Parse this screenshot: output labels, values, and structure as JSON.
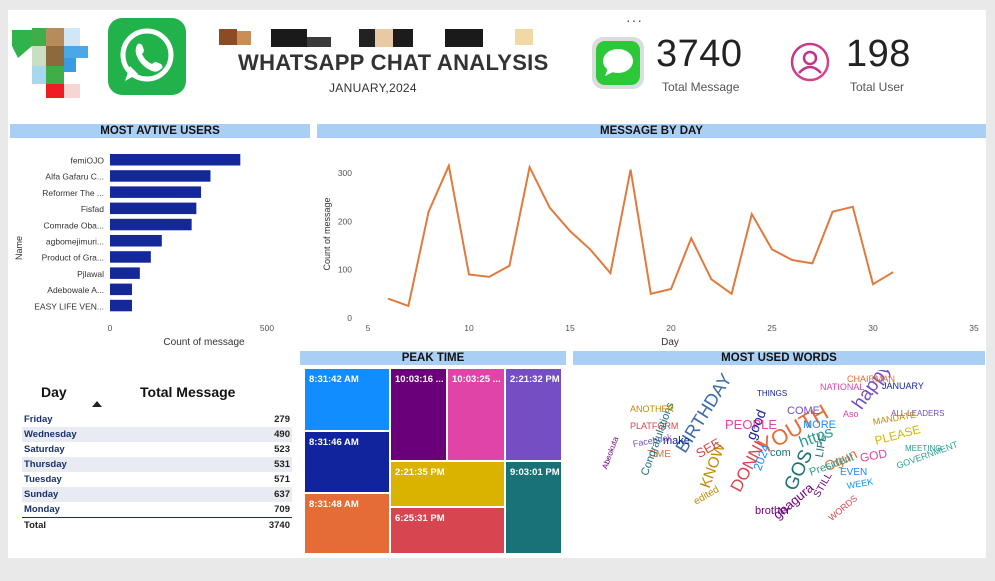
{
  "header": {
    "title": "WHATSAPP CHAT ANALYSIS",
    "subtitle": "JANUARY,2024",
    "more_options": "···"
  },
  "kpis": {
    "total_message_value": "3740",
    "total_message_label": "Total Message",
    "total_user_value": "198",
    "total_user_label": "Total User"
  },
  "active_users": {
    "banner": "MOST AVTIVE USERS",
    "ylabel": "Name",
    "xlabel": "Count of message",
    "xticks": [
      "0",
      "500"
    ],
    "xmax": 500,
    "bar_color": "#14289a",
    "users": [
      {
        "name": "femiOJO",
        "count": 415
      },
      {
        "name": "Alfa Gafaru C...",
        "count": 320
      },
      {
        "name": "Reformer The ...",
        "count": 290
      },
      {
        "name": "Fisfad",
        "count": 275
      },
      {
        "name": "Comrade Oba...",
        "count": 260
      },
      {
        "name": "agbomejimuri...",
        "count": 165
      },
      {
        "name": "Product of Gra...",
        "count": 130
      },
      {
        "name": "Pjlawal",
        "count": 95
      },
      {
        "name": "Adebowale A...",
        "count": 70
      },
      {
        "name": "EASY LIFE VEN...",
        "count": 70
      }
    ]
  },
  "chart_data": {
    "type": "line",
    "title": "MESSAGE BY DAY",
    "xlabel": "Day",
    "ylabel": "Count of message",
    "xlim": [
      5,
      35
    ],
    "ylim": [
      0,
      300
    ],
    "xticks": [
      5,
      10,
      15,
      20,
      25,
      30,
      35
    ],
    "yticks": [
      0,
      100,
      200,
      300
    ],
    "color": "#e07a3f",
    "x": [
      6,
      7,
      8,
      9,
      10,
      11,
      12,
      13,
      14,
      15,
      16,
      17,
      18,
      19,
      20,
      21,
      22,
      23,
      24,
      25,
      26,
      27,
      28,
      29,
      30,
      31
    ],
    "y": [
      40,
      25,
      220,
      315,
      90,
      85,
      108,
      312,
      228,
      180,
      142,
      93,
      307,
      50,
      60,
      165,
      80,
      50,
      215,
      142,
      120,
      113,
      220,
      230,
      70,
      95
    ]
  },
  "peak_time": {
    "banner": "PEAK TIME",
    "tiles": [
      {
        "label": "8:31:42 AM",
        "color": "#118dff"
      },
      {
        "label": "8:31:46 AM",
        "color": "#12239e"
      },
      {
        "label": "8:31:48 AM",
        "color": "#e66c37"
      },
      {
        "label": "10:03:16 ...",
        "color": "#6b007b"
      },
      {
        "label": "10:03:25 ...",
        "color": "#e044a7"
      },
      {
        "label": "2:21:32 PM",
        "color": "#744ec2"
      },
      {
        "label": "2:21:35 PM",
        "color": "#d9b300"
      },
      {
        "label": "6:25:31 PM",
        "color": "#d64550"
      },
      {
        "label": "9:03:01 PM",
        "color": "#197278"
      }
    ]
  },
  "day_table": {
    "col_day": "Day",
    "col_total": "Total Message",
    "rows": [
      {
        "day": "Friday",
        "total": "279"
      },
      {
        "day": "Wednesday",
        "total": "490"
      },
      {
        "day": "Saturday",
        "total": "523"
      },
      {
        "day": "Thursday",
        "total": "531"
      },
      {
        "day": "Tuesday",
        "total": "571"
      },
      {
        "day": "Sunday",
        "total": "637"
      },
      {
        "day": "Monday",
        "total": "709"
      }
    ],
    "total_label": "Total",
    "total_value": "3740"
  },
  "words": {
    "banner": "MOST USED WORDS",
    "items": [
      {
        "text": "BIRTHDAY",
        "color": "#3a6aa8"
      },
      {
        "text": "YOUTH",
        "color": "#e66c37"
      },
      {
        "text": "happy",
        "color": "#744ec2"
      },
      {
        "text": "DONNI",
        "color": "#d64550"
      },
      {
        "text": "GOS",
        "color": "#197278"
      },
      {
        "text": "KNOW",
        "color": "#c08a00"
      },
      {
        "text": "PEOPLE",
        "color": "#e044a7"
      },
      {
        "text": "https",
        "color": "#2a9d8f"
      },
      {
        "text": "gbagura",
        "color": "#6b007b"
      },
      {
        "text": "PLEASE",
        "color": "#d9b300"
      },
      {
        "text": "MORE",
        "color": "#118dff"
      },
      {
        "text": "good",
        "color": "#12239e"
      },
      {
        "text": "Ogun",
        "color": "#e66c37"
      },
      {
        "text": "LIFE",
        "color": "#197278"
      },
      {
        "text": "COME",
        "color": "#744ec2"
      },
      {
        "text": "SEE",
        "color": "#d64550"
      },
      {
        "text": "2024",
        "color": "#118dff"
      },
      {
        "text": "edited",
        "color": "#c08a00"
      },
      {
        "text": "brother",
        "color": "#6b007b"
      },
      {
        "text": "President",
        "color": "#2a9d8f"
      },
      {
        "text": "GOD",
        "color": "#e044a7"
      },
      {
        "text": "make",
        "color": "#12239e"
      },
      {
        "text": "TIME",
        "color": "#e66c37"
      },
      {
        "text": "Facebook",
        "color": "#744ec2"
      },
      {
        "text": "PLATFORM",
        "color": "#d64550"
      },
      {
        "text": "Congratulations",
        "color": "#197278"
      },
      {
        "text": "ANOTHER",
        "color": "#c08a00"
      },
      {
        "text": "STILL",
        "color": "#6b007b"
      },
      {
        "text": "EVEN",
        "color": "#118dff"
      },
      {
        "text": "GOVERNMENT",
        "color": "#2a9d8f"
      },
      {
        "text": "NATIONAL",
        "color": "#e044a7"
      },
      {
        "text": "CHAIRMAN",
        "color": "#e66c37"
      },
      {
        "text": "JANUARY",
        "color": "#12239e"
      },
      {
        "text": "ALL LEADERS",
        "color": "#744ec2"
      },
      {
        "text": "WORDS",
        "color": "#d64550"
      },
      {
        "text": "com",
        "color": "#197278"
      },
      {
        "text": "MANDATE",
        "color": "#c08a00"
      },
      {
        "text": "MEETING",
        "color": "#2a9d8f"
      },
      {
        "text": "Abeokuta",
        "color": "#6b007b"
      },
      {
        "text": "WEEK",
        "color": "#118dff"
      },
      {
        "text": "Aso",
        "color": "#e044a7"
      },
      {
        "text": "THINGS",
        "color": "#12239e"
      }
    ]
  }
}
